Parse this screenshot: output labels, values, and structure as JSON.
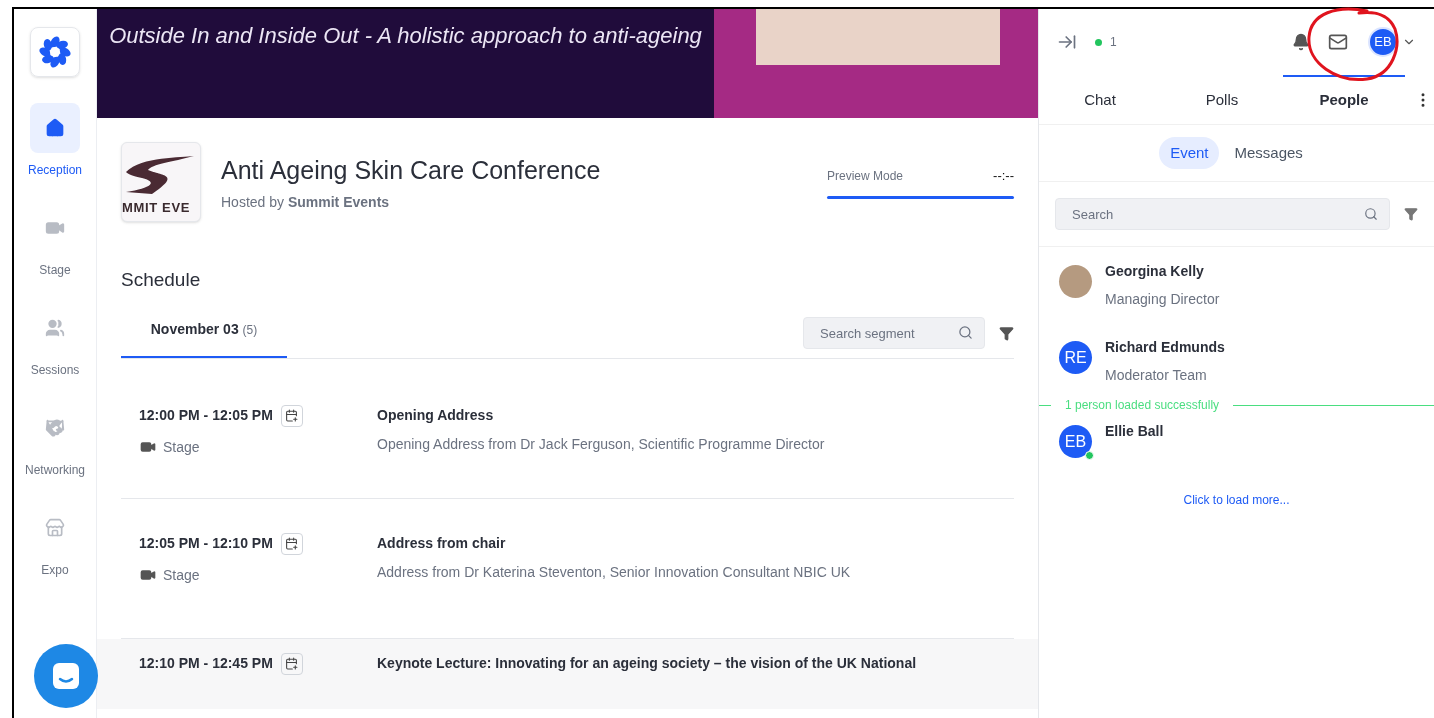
{
  "banner": {
    "title": "Outside In and Inside Out - A holistic approach to anti-ageing"
  },
  "sidebar": {
    "items": [
      {
        "label": "Reception",
        "kind": "home",
        "selected": true
      },
      {
        "label": "Stage",
        "kind": "stage",
        "selected": false
      },
      {
        "label": "Sessions",
        "kind": "sessions",
        "selected": false
      },
      {
        "label": "Networking",
        "kind": "networking",
        "selected": false
      },
      {
        "label": "Expo",
        "kind": "expo",
        "selected": false
      }
    ]
  },
  "event": {
    "logo_text": "MMIT EVE",
    "title": "Anti Ageing Skin Care Conference",
    "hosted_by": "Hosted by **Summit Events**",
    "preview_label": "Preview Mode",
    "preview_time": "--:--"
  },
  "schedule": {
    "heading": "Schedule",
    "tabs": [
      {
        "label": "November 03",
        "count": "(5)",
        "selected": true
      }
    ],
    "search_placeholder": "Search segment",
    "sessions": [
      {
        "time": "12:00 PM - 12:05 PM",
        "location": "Stage",
        "title": "Opening Address",
        "description": "Opening Address from Dr Jack Ferguson, Scientific Programme Director"
      },
      {
        "time": "12:05 PM - 12:10 PM",
        "location": "Stage",
        "title": "Address from chair",
        "description": "Address from Dr Katerina Steventon, Senior Innovation Consultant NBIC UK"
      },
      {
        "time": "12:10 PM - 12:45 PM",
        "title": "Keynote Lecture: Innovating for an ageing society – the vision of the UK National"
      }
    ]
  },
  "panel": {
    "online_count": "1",
    "avatar_initials": "EB",
    "tabs": [
      {
        "label": "Chat",
        "selected": false
      },
      {
        "label": "Polls",
        "selected": false
      },
      {
        "label": "People",
        "selected": true
      }
    ],
    "subtabs": [
      {
        "label": "Event",
        "selected": true
      },
      {
        "label": "Messages",
        "selected": false
      }
    ],
    "search_placeholder": "Search",
    "entries": [
      {
        "kind": "person",
        "name": "Georgina Kelly",
        "role": "Managing Director",
        "has_photo": true,
        "online": false
      },
      {
        "kind": "person",
        "name": "Richard Edmunds",
        "role": "Moderator Team",
        "has_photo": false,
        "initials": "RE",
        "online": false
      },
      {
        "kind": "notice",
        "text": "1 person loaded successfully"
      },
      {
        "kind": "person",
        "name": "Ellie Ball",
        "has_photo": false,
        "initials": "EB",
        "online": true
      }
    ],
    "load_more": "Click to load more..."
  }
}
